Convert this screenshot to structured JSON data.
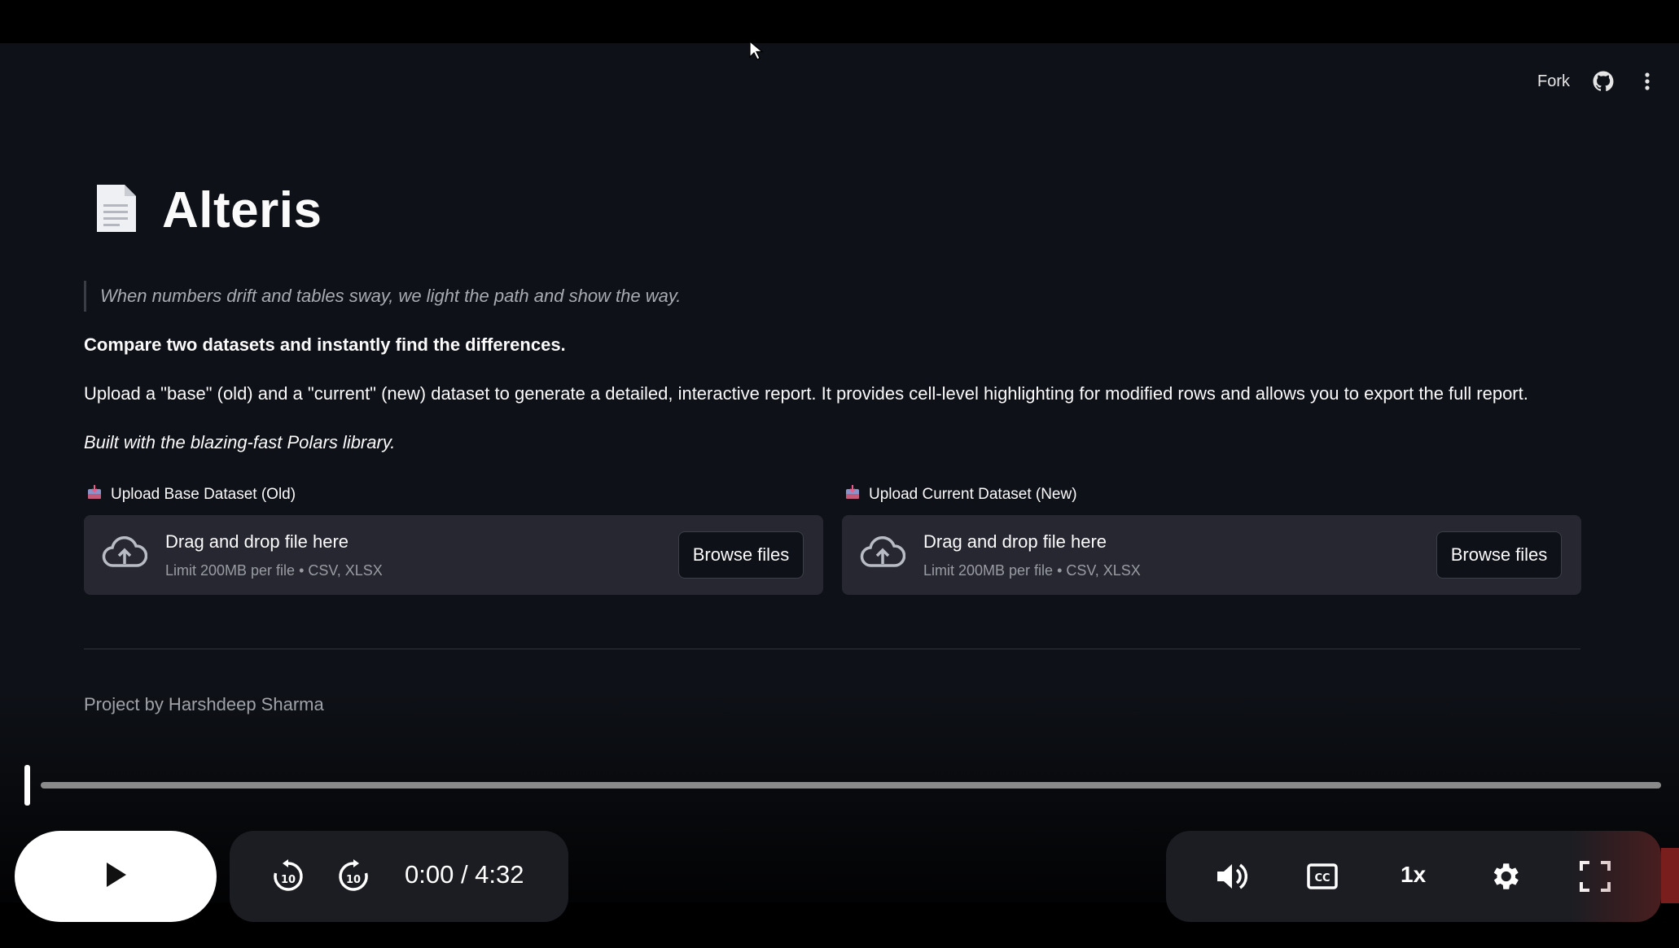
{
  "topbar": {
    "fork_label": "Fork"
  },
  "header": {
    "title": "Alteris",
    "doc_icon": "page-icon"
  },
  "intro": {
    "quote": "When numbers drift and tables sway, we light the path and show the way.",
    "lead": "Compare two datasets and instantly find the differences.",
    "description": "Upload a \"base\" (old) and a \"current\" (new) dataset to generate a detailed, interactive report. It provides cell-level highlighting for modified rows and allows you to export the full report.",
    "built_with": "Built with the blazing-fast Polars library."
  },
  "uploaders": {
    "base": {
      "label": "Upload Base Dataset (Old)",
      "drop_text": "Drag and drop file here",
      "limit_text": "Limit 200MB per file • CSV, XLSX",
      "button": "Browse files"
    },
    "current": {
      "label": "Upload Current Dataset (New)",
      "drop_text": "Drag and drop file here",
      "limit_text": "Limit 200MB per file • CSV, XLSX",
      "button": "Browse files"
    }
  },
  "footer": {
    "credit": "Project by Harshdeep Sharma"
  },
  "player": {
    "time": "0:00 / 4:32",
    "speed": "1x",
    "progress": 0
  },
  "colors": {
    "app_bg": "#0e1117",
    "dropzone_bg": "#262730",
    "player_bar": "#1c1d22"
  }
}
